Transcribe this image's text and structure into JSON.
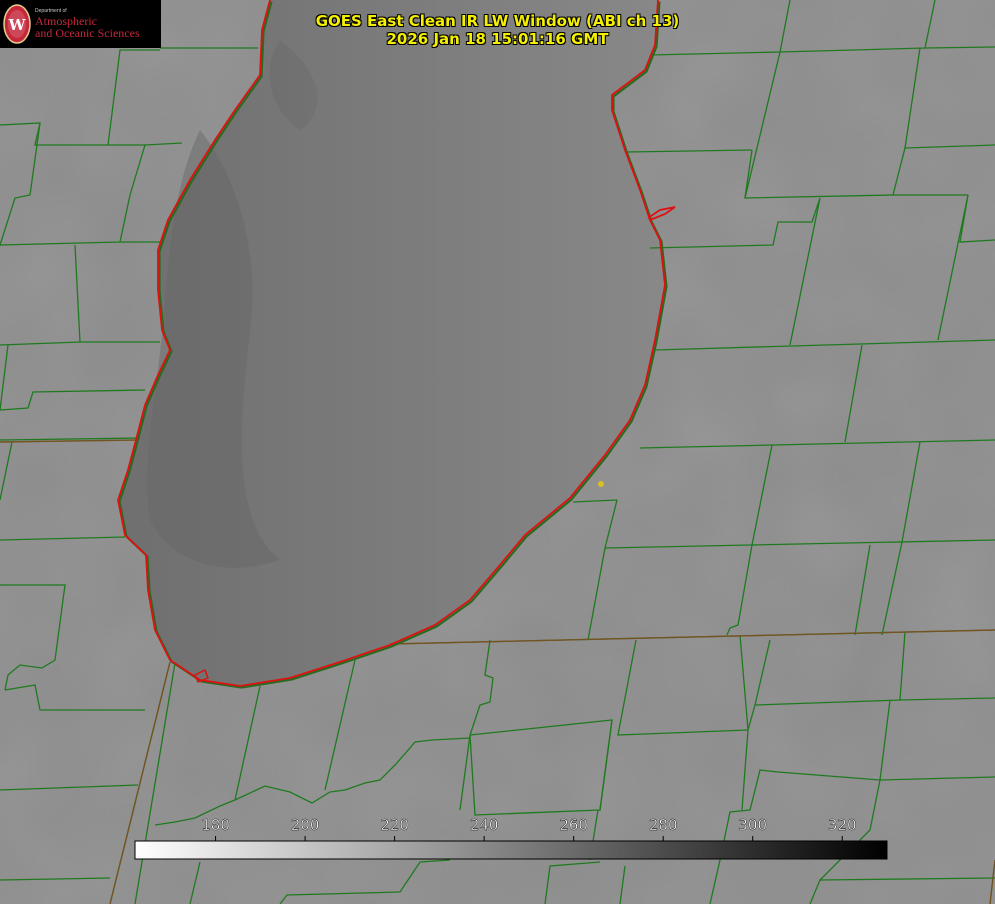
{
  "title": {
    "line1": "GOES East Clean IR LW Window (ABI ch 13)",
    "line2": "2026 Jan 18 15:01:16 GMT"
  },
  "logo": {
    "department": "Department of",
    "line1": "Atmospheric",
    "line2": "and Oceanic Sciences",
    "icon": "uw-crest-icon"
  },
  "colorbar": {
    "ticks": [
      180,
      200,
      220,
      240,
      260,
      280,
      300,
      320
    ],
    "min": 162,
    "max": 330
  },
  "colors": {
    "county_lines": "#1f7a1f",
    "coastline": "#e01010",
    "title": "#f5f000",
    "logo_text": "#c5283d",
    "land": "#8e8e8e",
    "lake": "#7a7a7a",
    "marker": "#d8c020"
  },
  "marker": {
    "icon": "station-dot-icon"
  }
}
